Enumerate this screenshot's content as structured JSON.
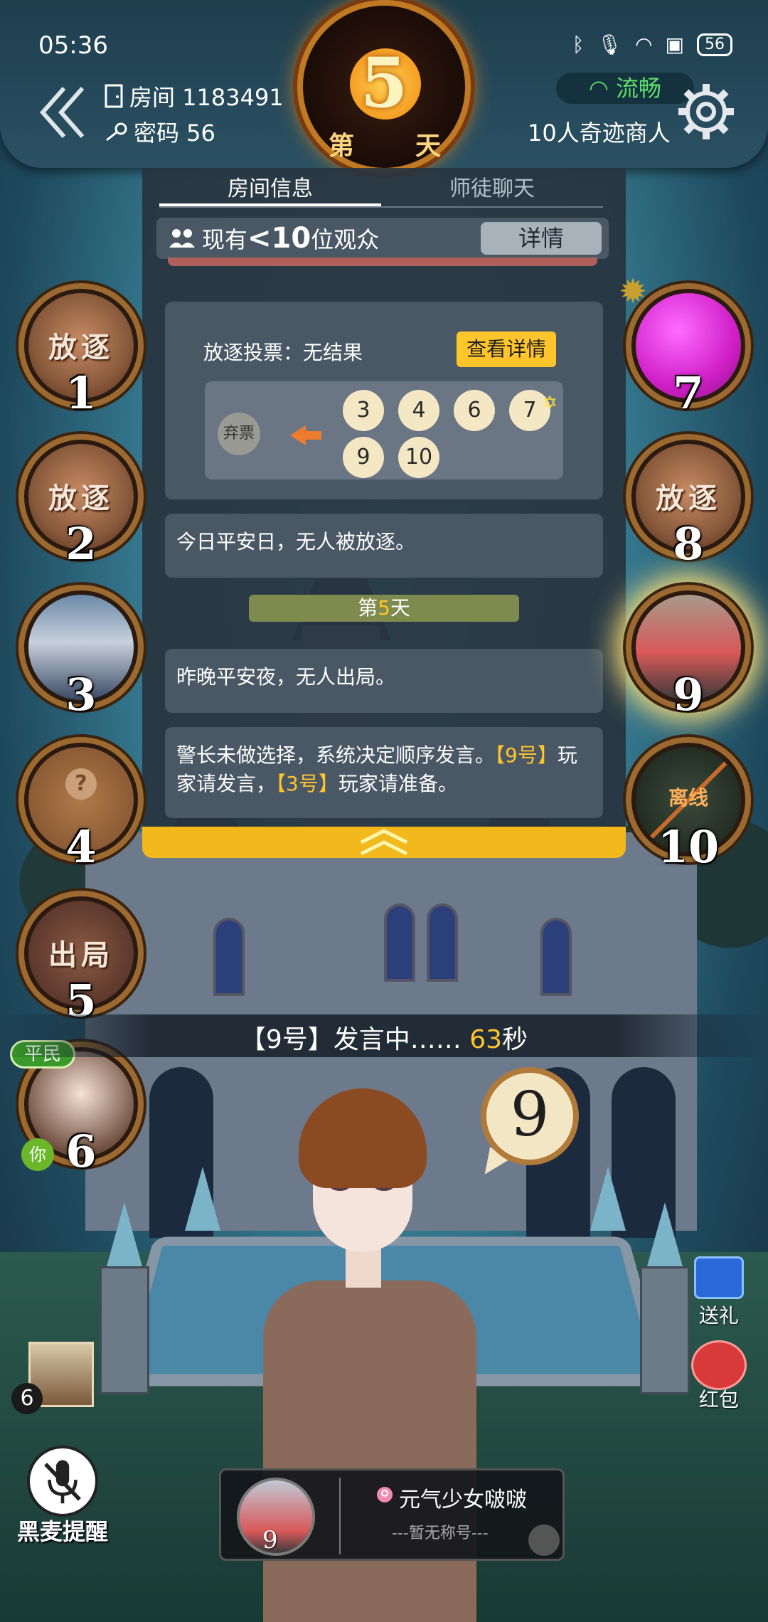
{
  "status_bar": {
    "time": "05:36",
    "icons": [
      "bluetooth-icon",
      "mic-icon",
      "wifi-icon",
      "sim-icon"
    ],
    "battery": "56"
  },
  "header": {
    "room_label": "房间 1183491",
    "password_label": "密码 56",
    "day_pre": "第",
    "day_number": "5",
    "day_post": "天",
    "network_status": "流畅",
    "game_mode": "10人奇迹商人",
    "colors": {
      "accent": "#c07a24",
      "network": "#5ee06a"
    }
  },
  "panel": {
    "tabs": [
      {
        "label": "房间信息",
        "active": true
      },
      {
        "label": "师徒聊天",
        "active": false
      }
    ],
    "audience": {
      "prefix": "现有",
      "count": "<10",
      "suffix": "位观众",
      "detail_button": "详情"
    },
    "vote": {
      "title": "放逐投票：无结果",
      "detail_button": "查看详情",
      "abstain_label": "弃票",
      "voters": [
        "3",
        "4",
        "6",
        "7",
        "9",
        "10"
      ],
      "starred_voter": "7"
    },
    "messages": [
      {
        "text": "今日平安日，无人被放逐。"
      },
      {
        "text": "昨晚平安夜，无人出局。"
      },
      {
        "text": "警长未做选择，系统决定顺序发言。",
        "hl1": "【9号】",
        "mid": "玩家请发言，",
        "hl2": "【3号】",
        "tail": "玩家请准备。"
      }
    ],
    "day_divider": {
      "pre": "第",
      "num": "5",
      "post": "天"
    }
  },
  "seats": [
    {
      "number": "1",
      "state": "放逐"
    },
    {
      "number": "2",
      "state": "放逐"
    },
    {
      "number": "3",
      "state": "avatar"
    },
    {
      "number": "4",
      "state": "unknown"
    },
    {
      "number": "5",
      "state": "出局"
    },
    {
      "number": "6",
      "state": "self",
      "role": "平民",
      "you": "你"
    },
    {
      "number": "7",
      "state": "sheriff-avatar"
    },
    {
      "number": "8",
      "state": "放逐"
    },
    {
      "number": "9",
      "state": "speaking"
    },
    {
      "number": "10",
      "state": "离线"
    }
  ],
  "speaking": {
    "prefix": "【9号】发言中…… ",
    "seconds": "63",
    "suffix": "秒",
    "bubble_number": "9"
  },
  "right_buttons": {
    "gift": "送礼",
    "red_packet": "红包"
  },
  "bottom_left": {
    "spectator_count": "6",
    "mic_reminder": "黑麦提醒"
  },
  "speaker_card": {
    "seat": "9",
    "name": "元气少女啵啵",
    "title": "---暂无称号---"
  }
}
